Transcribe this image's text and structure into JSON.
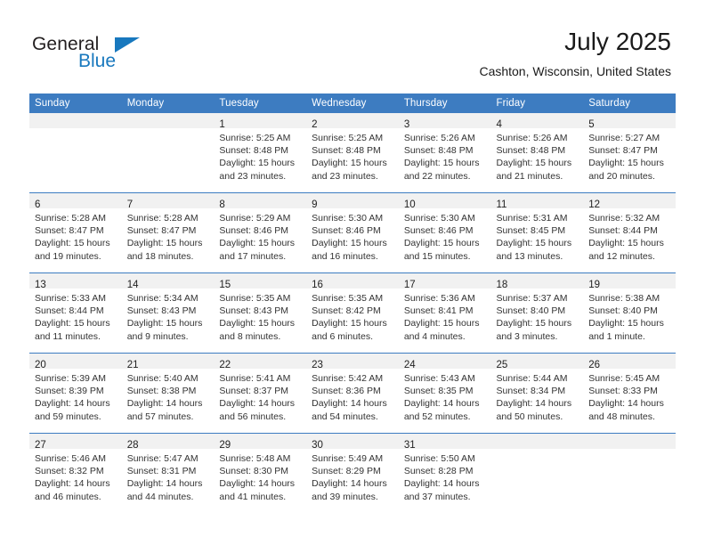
{
  "brand": {
    "name_part1": "General",
    "name_part2": "Blue",
    "accent_color": "#1878be"
  },
  "header": {
    "month_title": "July 2025",
    "location": "Cashton, Wisconsin, United States"
  },
  "calendar": {
    "header_color": "#3d7cc1",
    "daynum_band_color": "#f1f1f1",
    "weekday_headers": [
      "Sunday",
      "Monday",
      "Tuesday",
      "Wednesday",
      "Thursday",
      "Friday",
      "Saturday"
    ],
    "weeks": [
      [
        {
          "day": "",
          "lines": []
        },
        {
          "day": "",
          "lines": []
        },
        {
          "day": "1",
          "lines": [
            "Sunrise: 5:25 AM",
            "Sunset: 8:48 PM",
            "Daylight: 15 hours",
            "and 23 minutes."
          ]
        },
        {
          "day": "2",
          "lines": [
            "Sunrise: 5:25 AM",
            "Sunset: 8:48 PM",
            "Daylight: 15 hours",
            "and 23 minutes."
          ]
        },
        {
          "day": "3",
          "lines": [
            "Sunrise: 5:26 AM",
            "Sunset: 8:48 PM",
            "Daylight: 15 hours",
            "and 22 minutes."
          ]
        },
        {
          "day": "4",
          "lines": [
            "Sunrise: 5:26 AM",
            "Sunset: 8:48 PM",
            "Daylight: 15 hours",
            "and 21 minutes."
          ]
        },
        {
          "day": "5",
          "lines": [
            "Sunrise: 5:27 AM",
            "Sunset: 8:47 PM",
            "Daylight: 15 hours",
            "and 20 minutes."
          ]
        }
      ],
      [
        {
          "day": "6",
          "lines": [
            "Sunrise: 5:28 AM",
            "Sunset: 8:47 PM",
            "Daylight: 15 hours",
            "and 19 minutes."
          ]
        },
        {
          "day": "7",
          "lines": [
            "Sunrise: 5:28 AM",
            "Sunset: 8:47 PM",
            "Daylight: 15 hours",
            "and 18 minutes."
          ]
        },
        {
          "day": "8",
          "lines": [
            "Sunrise: 5:29 AM",
            "Sunset: 8:46 PM",
            "Daylight: 15 hours",
            "and 17 minutes."
          ]
        },
        {
          "day": "9",
          "lines": [
            "Sunrise: 5:30 AM",
            "Sunset: 8:46 PM",
            "Daylight: 15 hours",
            "and 16 minutes."
          ]
        },
        {
          "day": "10",
          "lines": [
            "Sunrise: 5:30 AM",
            "Sunset: 8:46 PM",
            "Daylight: 15 hours",
            "and 15 minutes."
          ]
        },
        {
          "day": "11",
          "lines": [
            "Sunrise: 5:31 AM",
            "Sunset: 8:45 PM",
            "Daylight: 15 hours",
            "and 13 minutes."
          ]
        },
        {
          "day": "12",
          "lines": [
            "Sunrise: 5:32 AM",
            "Sunset: 8:44 PM",
            "Daylight: 15 hours",
            "and 12 minutes."
          ]
        }
      ],
      [
        {
          "day": "13",
          "lines": [
            "Sunrise: 5:33 AM",
            "Sunset: 8:44 PM",
            "Daylight: 15 hours",
            "and 11 minutes."
          ]
        },
        {
          "day": "14",
          "lines": [
            "Sunrise: 5:34 AM",
            "Sunset: 8:43 PM",
            "Daylight: 15 hours",
            "and 9 minutes."
          ]
        },
        {
          "day": "15",
          "lines": [
            "Sunrise: 5:35 AM",
            "Sunset: 8:43 PM",
            "Daylight: 15 hours",
            "and 8 minutes."
          ]
        },
        {
          "day": "16",
          "lines": [
            "Sunrise: 5:35 AM",
            "Sunset: 8:42 PM",
            "Daylight: 15 hours",
            "and 6 minutes."
          ]
        },
        {
          "day": "17",
          "lines": [
            "Sunrise: 5:36 AM",
            "Sunset: 8:41 PM",
            "Daylight: 15 hours",
            "and 4 minutes."
          ]
        },
        {
          "day": "18",
          "lines": [
            "Sunrise: 5:37 AM",
            "Sunset: 8:40 PM",
            "Daylight: 15 hours",
            "and 3 minutes."
          ]
        },
        {
          "day": "19",
          "lines": [
            "Sunrise: 5:38 AM",
            "Sunset: 8:40 PM",
            "Daylight: 15 hours",
            "and 1 minute."
          ]
        }
      ],
      [
        {
          "day": "20",
          "lines": [
            "Sunrise: 5:39 AM",
            "Sunset: 8:39 PM",
            "Daylight: 14 hours",
            "and 59 minutes."
          ]
        },
        {
          "day": "21",
          "lines": [
            "Sunrise: 5:40 AM",
            "Sunset: 8:38 PM",
            "Daylight: 14 hours",
            "and 57 minutes."
          ]
        },
        {
          "day": "22",
          "lines": [
            "Sunrise: 5:41 AM",
            "Sunset: 8:37 PM",
            "Daylight: 14 hours",
            "and 56 minutes."
          ]
        },
        {
          "day": "23",
          "lines": [
            "Sunrise: 5:42 AM",
            "Sunset: 8:36 PM",
            "Daylight: 14 hours",
            "and 54 minutes."
          ]
        },
        {
          "day": "24",
          "lines": [
            "Sunrise: 5:43 AM",
            "Sunset: 8:35 PM",
            "Daylight: 14 hours",
            "and 52 minutes."
          ]
        },
        {
          "day": "25",
          "lines": [
            "Sunrise: 5:44 AM",
            "Sunset: 8:34 PM",
            "Daylight: 14 hours",
            "and 50 minutes."
          ]
        },
        {
          "day": "26",
          "lines": [
            "Sunrise: 5:45 AM",
            "Sunset: 8:33 PM",
            "Daylight: 14 hours",
            "and 48 minutes."
          ]
        }
      ],
      [
        {
          "day": "27",
          "lines": [
            "Sunrise: 5:46 AM",
            "Sunset: 8:32 PM",
            "Daylight: 14 hours",
            "and 46 minutes."
          ]
        },
        {
          "day": "28",
          "lines": [
            "Sunrise: 5:47 AM",
            "Sunset: 8:31 PM",
            "Daylight: 14 hours",
            "and 44 minutes."
          ]
        },
        {
          "day": "29",
          "lines": [
            "Sunrise: 5:48 AM",
            "Sunset: 8:30 PM",
            "Daylight: 14 hours",
            "and 41 minutes."
          ]
        },
        {
          "day": "30",
          "lines": [
            "Sunrise: 5:49 AM",
            "Sunset: 8:29 PM",
            "Daylight: 14 hours",
            "and 39 minutes."
          ]
        },
        {
          "day": "31",
          "lines": [
            "Sunrise: 5:50 AM",
            "Sunset: 8:28 PM",
            "Daylight: 14 hours",
            "and 37 minutes."
          ]
        },
        {
          "day": "",
          "lines": []
        },
        {
          "day": "",
          "lines": []
        }
      ]
    ]
  }
}
